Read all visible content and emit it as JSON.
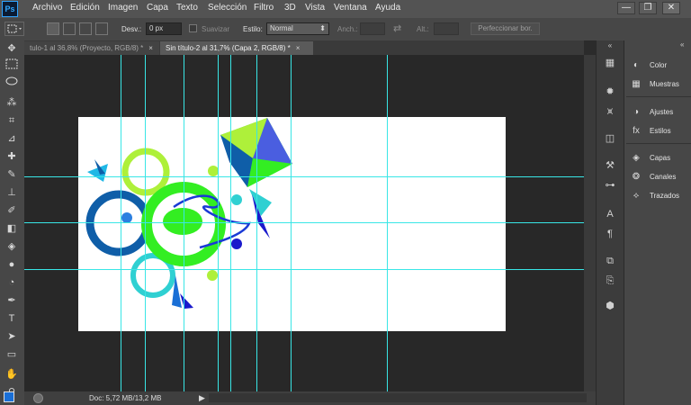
{
  "app": {
    "logo": "Ps"
  },
  "menu": [
    "Archivo",
    "Edición",
    "Imagen",
    "Capa",
    "Texto",
    "Selección",
    "Filtro",
    "3D",
    "Vista",
    "Ventana",
    "Ayuda"
  ],
  "window_controls": {
    "minimize": "—",
    "restore": "❐",
    "close": "✕"
  },
  "options_bar": {
    "feather_label": "Desv.:",
    "feather_value": "0 px",
    "antialias_label": "Suavizar",
    "style_label": "Estilo:",
    "style_value": "Normal",
    "width_label": "Anch.:",
    "height_label": "Alt.:",
    "refine_button": "Perfeccionar bor."
  },
  "tabs": [
    {
      "label": "tulo-1 al 36,8% (Proyecto, RGB/8) *",
      "close": "×",
      "active": false
    },
    {
      "label": "Sin título-2 al 31,7% (Capa 2, RGB/8) *",
      "close": "×",
      "active": true
    }
  ],
  "status": {
    "doc_info": "Doc: 5,72 MB/13,2 MB"
  },
  "panels": {
    "collapse": "«",
    "items": [
      "Color",
      "Muestras",
      "Ajustes",
      "Estilos",
      "Capas",
      "Canales",
      "Trazados"
    ]
  },
  "colors": {
    "guide": "#39e6e6",
    "foreground": "#1a6fd6",
    "background": "#ffffff",
    "lime": "#aef03a",
    "green": "#33ee22",
    "blue": "#0f5ea8",
    "teal": "#2fd0d2",
    "navy": "#1a1acc"
  },
  "icons": {
    "tools": [
      "move-icon",
      "marquee-icon",
      "lasso-icon",
      "magic-wand-icon",
      "crop-icon",
      "eyedropper-icon",
      "healing-brush-icon",
      "brush-icon",
      "clone-stamp-icon",
      "history-brush-icon",
      "eraser-icon",
      "paint-bucket-icon",
      "blur-icon",
      "dodge-icon",
      "pen-icon",
      "type-icon",
      "path-selection-icon",
      "shape-icon",
      "hand-icon",
      "zoom-icon"
    ]
  }
}
